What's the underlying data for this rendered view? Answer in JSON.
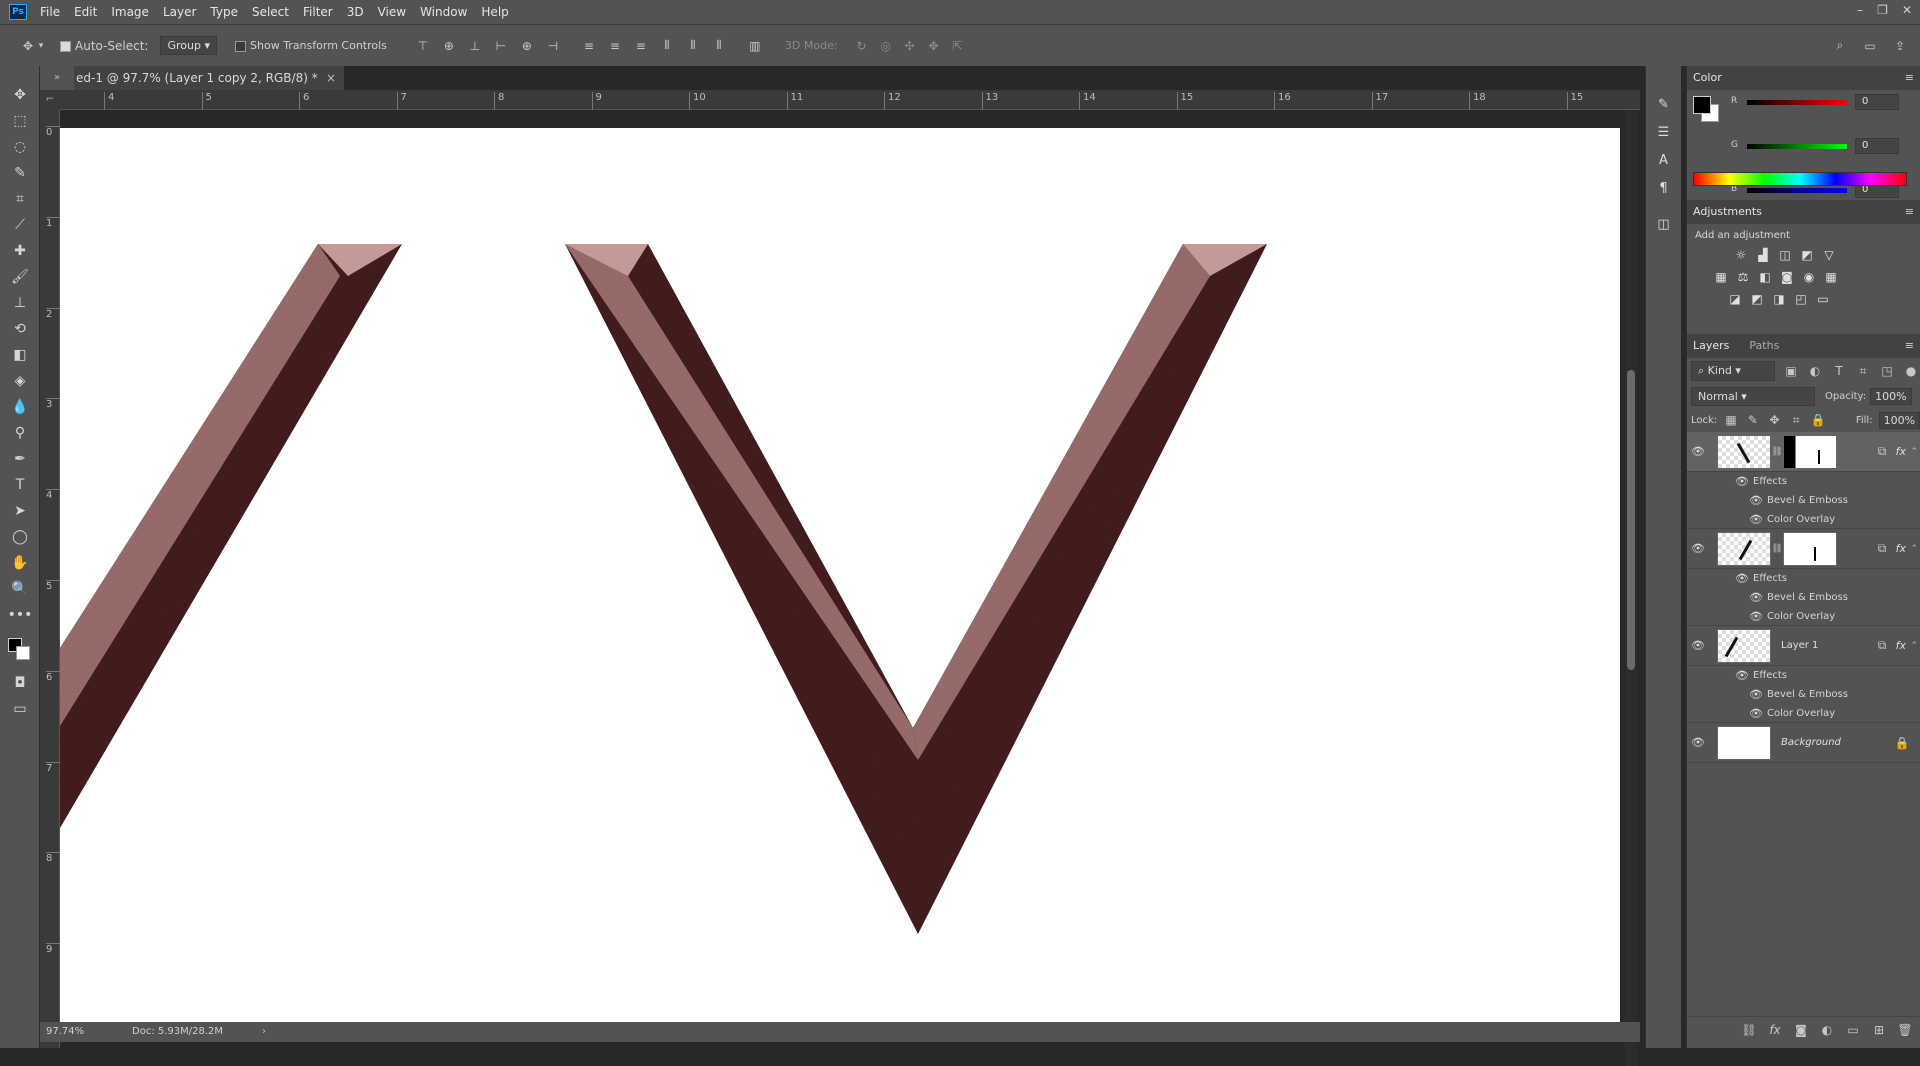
{
  "app": {
    "logo": "Ps",
    "menus": [
      "File",
      "Edit",
      "Image",
      "Layer",
      "Type",
      "Select",
      "Filter",
      "3D",
      "View",
      "Window",
      "Help"
    ],
    "window_controls": [
      "–",
      "❐",
      "✕"
    ]
  },
  "options": {
    "auto_select_label": "Auto-Select:",
    "auto_select_value": "Group",
    "show_transform_label": "Show Transform Controls",
    "mode3d_label": "3D Mode:"
  },
  "document": {
    "tab_title": "ed-1 @ 97.7% (Layer 1 copy 2, RGB/8) *",
    "tab_close": "×",
    "hruler_ticks": [
      "4",
      "5",
      "6",
      "7",
      "8",
      "9",
      "10",
      "11",
      "12",
      "13",
      "14",
      "15",
      "16",
      "17",
      "18",
      "15"
    ],
    "vruler_ticks": [
      "0",
      "1",
      "2",
      "3",
      "4",
      "5",
      "6",
      "7",
      "8",
      "9"
    ],
    "zoom": "97.74%",
    "doc_size": "Doc: 5.93M/28.2M"
  },
  "color_panel": {
    "title": "Color",
    "channels": [
      {
        "label": "R",
        "value": "0",
        "color": "#d42020"
      },
      {
        "label": "G",
        "value": "0",
        "color": "#20b020"
      },
      {
        "label": "B",
        "value": "0",
        "color": "#2040d0"
      }
    ],
    "foreground": "#000000",
    "background": "#ffffff"
  },
  "adjustments_panel": {
    "title": "Adjustments",
    "subtitle": "Add an adjustment"
  },
  "layers_panel": {
    "tabs": [
      "Layers",
      "Paths"
    ],
    "filter_kind": "Kind",
    "blend_mode": "Normal",
    "opacity_label": "Opacity:",
    "opacity_value": "100%",
    "lock_label": "Lock:",
    "fill_label": "Fill:",
    "fill_value": "100%",
    "layers": [
      {
        "name": "",
        "effects_label": "Effects",
        "effects": [
          "Bevel & Emboss",
          "Color Overlay"
        ],
        "has_mask": true
      },
      {
        "name": "",
        "effects_label": "Effects",
        "effects": [
          "Bevel & Emboss",
          "Color Overlay"
        ],
        "has_mask": true
      },
      {
        "name": "Layer 1",
        "effects_label": "Effects",
        "effects": [
          "Bevel & Emboss",
          "Color Overlay"
        ],
        "has_mask": false
      },
      {
        "name": "Background",
        "effects_label": "",
        "effects": [],
        "has_mask": false
      }
    ]
  },
  "colors": {
    "ui_dark": "#535353",
    "panel_head": "#424242",
    "letter_face": "#a37573",
    "letter_shadow": "#4a2222"
  }
}
